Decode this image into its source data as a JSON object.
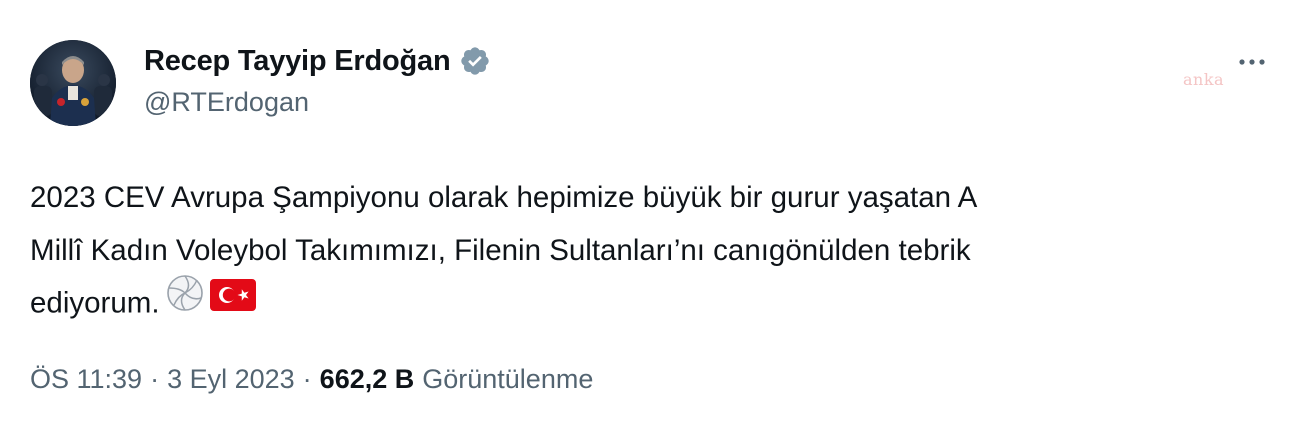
{
  "author": {
    "display_name": "Recep Tayyip Erdoğan",
    "handle": "@RTErdogan",
    "verified": true,
    "verified_color": "#829aab"
  },
  "watermark": "anka",
  "tweet": {
    "lines": [
      "2023 CEV Avrupa Şampiyonu olarak hepimize büyük bir gurur yaşatan A",
      "Millî Kadın Voleybol Takımımızı, Filenin Sultanları’nı canıgönülden tebrik",
      "ediyorum."
    ],
    "emojis": [
      "volleyball-emoji",
      "turkey-flag-emoji"
    ]
  },
  "meta": {
    "time": "ÖS 11:39",
    "separator": "·",
    "date": "3 Eyl 2023",
    "views_count": "662,2 B",
    "views_label": "Görüntülenme"
  },
  "icons": {
    "more": "more-horizontal-icon",
    "verified": "verified-badge-icon"
  },
  "colors": {
    "text_primary": "#0f1419",
    "text_secondary": "#536471",
    "flag_red": "#e30a17"
  }
}
